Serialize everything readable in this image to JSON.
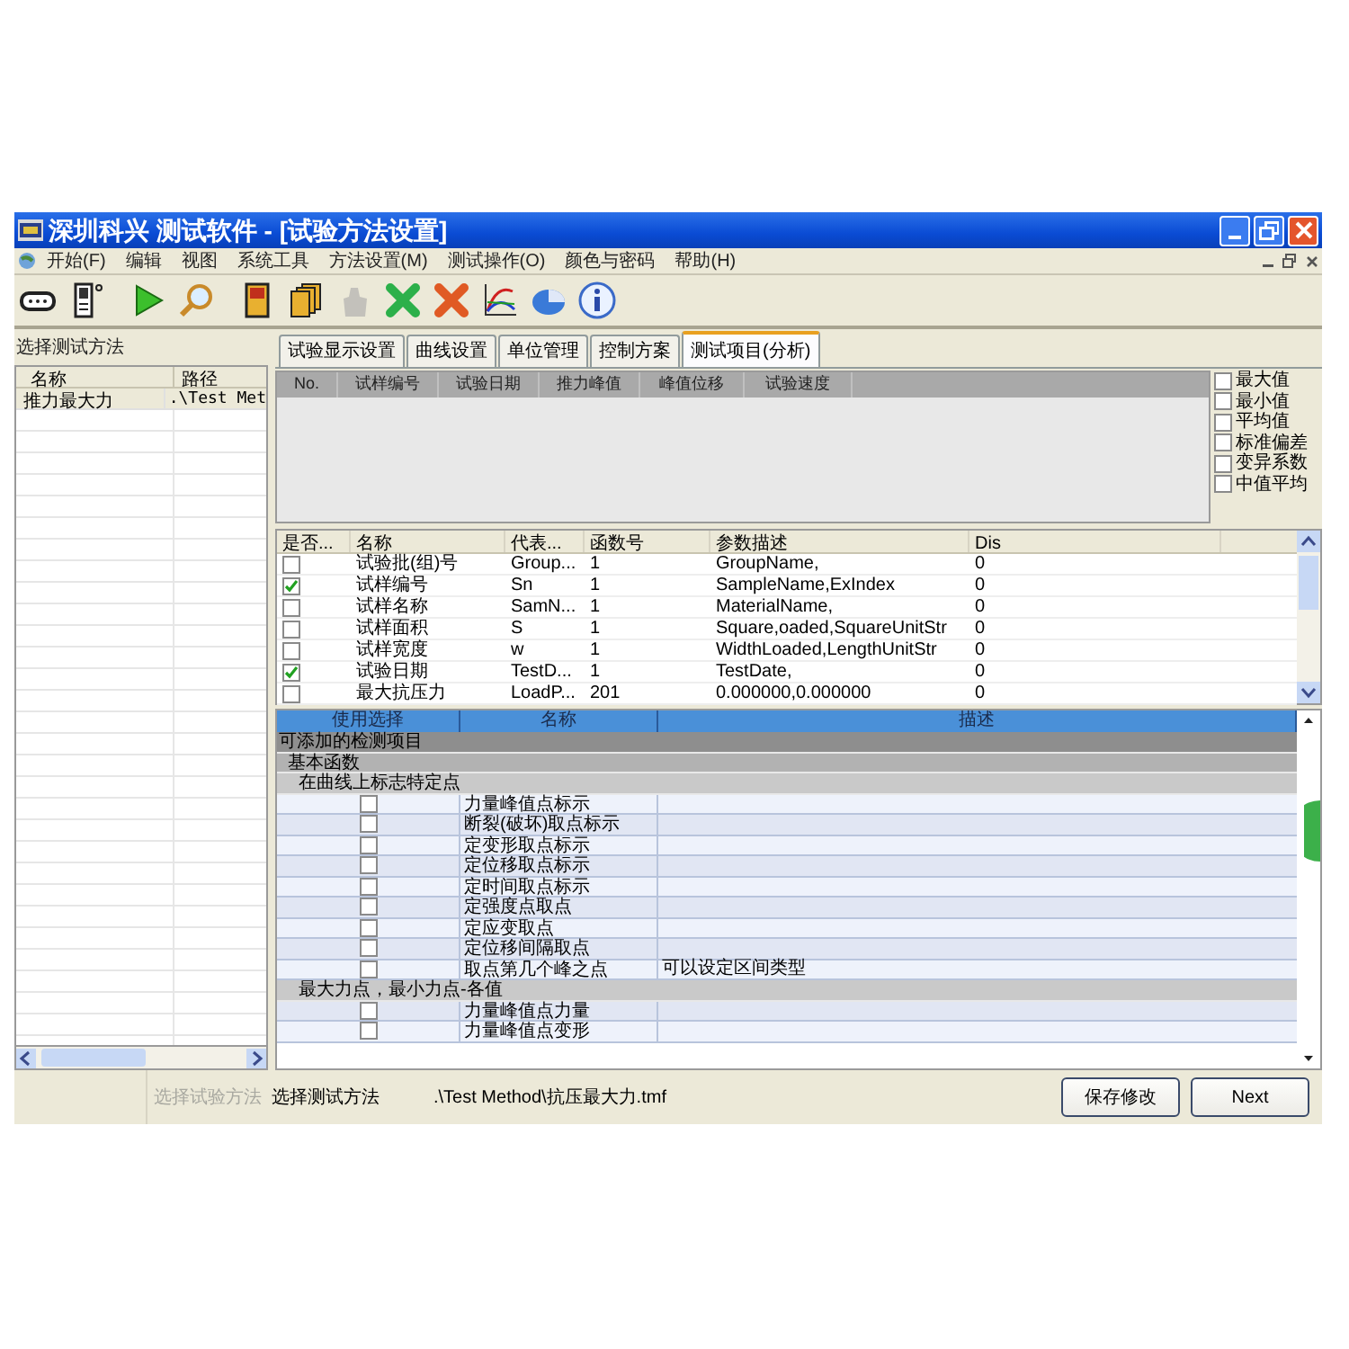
{
  "window": {
    "title": "深圳科兴 测试软件 - [试验方法设置]"
  },
  "menu": [
    "开始(F)",
    "编辑",
    "视图",
    "系统工具",
    "方法设置(M)",
    "测试操作(O)",
    "颜色与密码",
    "帮助(H)"
  ],
  "toolbar": [
    {
      "kind": "port",
      "disabled": false
    },
    {
      "kind": "device",
      "disabled": false
    },
    {
      "kind": "play",
      "disabled": false
    },
    {
      "kind": "search",
      "disabled": false
    },
    {
      "kind": "doc",
      "disabled": false
    },
    {
      "kind": "docs",
      "disabled": false
    },
    {
      "kind": "hand",
      "disabled": true
    },
    {
      "kind": "greenx",
      "disabled": false
    },
    {
      "kind": "redx",
      "disabled": false
    },
    {
      "kind": "chart",
      "disabled": false
    },
    {
      "kind": "pie",
      "disabled": false
    },
    {
      "kind": "info",
      "disabled": false
    }
  ],
  "left_panel": {
    "title": "选择测试方法",
    "columns": [
      "名称",
      "路径"
    ],
    "rows": [
      {
        "cells": [
          "推力最大力",
          ".\\Test Met"
        ],
        "selected": true
      }
    ],
    "button": {
      "label": "选择试验方法",
      "disabled": true
    }
  },
  "tabs": [
    {
      "label": "试验显示设置",
      "selected": false
    },
    {
      "label": "曲线设置",
      "selected": false
    },
    {
      "label": "单位管理",
      "selected": false
    },
    {
      "label": "控制方案",
      "selected": false
    },
    {
      "label": "测试项目(分析)",
      "selected": true
    }
  ],
  "results": {
    "columns": [
      "No.",
      "试样编号",
      "试验日期",
      "推力峰值",
      "峰值位移",
      "试验速度"
    ]
  },
  "statistics": [
    {
      "label": "最大值",
      "checked": false
    },
    {
      "label": "最小值",
      "checked": false
    },
    {
      "label": "平均值",
      "checked": false
    },
    {
      "label": "标准偏差",
      "checked": false
    },
    {
      "label": "变异系数",
      "checked": false
    },
    {
      "label": "中值平均",
      "checked": false
    }
  ],
  "parameters": {
    "columns": [
      "是否...",
      "名称",
      "代表...",
      "函数号",
      "参数描述",
      "Dis"
    ],
    "rows": [
      {
        "checked": false,
        "name": "试验批(组)号",
        "symbol": "Group...",
        "function_no": "1",
        "description": "GroupName,",
        "dis": "0"
      },
      {
        "checked": true,
        "name": "试样编号",
        "symbol": "Sn",
        "function_no": "1",
        "description": "SampleName,ExIndex",
        "dis": "0"
      },
      {
        "checked": false,
        "name": "试样名称",
        "symbol": "SamN...",
        "function_no": "1",
        "description": "MaterialName,",
        "dis": "0"
      },
      {
        "checked": false,
        "name": "试样面积",
        "symbol": "S",
        "function_no": "1",
        "description": "Square,oaded,SquareUnitStr",
        "dis": "0"
      },
      {
        "checked": false,
        "name": "试样宽度",
        "symbol": "w",
        "function_no": "1",
        "description": "WidthLoaded,LengthUnitStr",
        "dis": "0"
      },
      {
        "checked": true,
        "name": "试验日期",
        "symbol": "TestD...",
        "function_no": "1",
        "description": "TestDate,",
        "dis": "0"
      },
      {
        "checked": false,
        "name": "最大抗压力",
        "symbol": "LoadP...",
        "function_no": "201",
        "description": "0.000000,0.000000",
        "dis": "0"
      }
    ]
  },
  "items": {
    "columns": [
      "使用选择",
      "名称",
      "描述"
    ],
    "tree": [
      {
        "label": "可添加的检测项目",
        "children": [
          {
            "label": "基本函数",
            "children": [
              {
                "label": "在曲线上标志特定点",
                "items": [
                  {
                    "checked": false,
                    "name": "力量峰值点标示"
                  },
                  {
                    "checked": false,
                    "name": "断裂(破坏)取点标示"
                  },
                  {
                    "checked": false,
                    "name": "定变形取点标示"
                  },
                  {
                    "checked": false,
                    "name": "定位移取点标示"
                  },
                  {
                    "checked": false,
                    "name": "定时间取点标示"
                  },
                  {
                    "checked": false,
                    "name": "定强度点取点"
                  },
                  {
                    "checked": false,
                    "name": "定应变取点"
                  },
                  {
                    "checked": false,
                    "name": "定位移间隔取点"
                  },
                  {
                    "checked": false,
                    "name": "取点第几个峰之点",
                    "description": "可以设定区间类型"
                  }
                ]
              },
              {
                "label": "最大力点，最小力点-各值",
                "items": [
                  {
                    "checked": false,
                    "name": "力量峰值点力量"
                  },
                  {
                    "checked": false,
                    "name": "力量峰值点变形"
                  }
                ]
              }
            ]
          }
        ]
      }
    ]
  },
  "footer": {
    "label": "选择测试方法",
    "path": ".\\Test Method\\抗压最大力.tmf",
    "buttons": [
      "保存修改",
      "Next"
    ]
  }
}
